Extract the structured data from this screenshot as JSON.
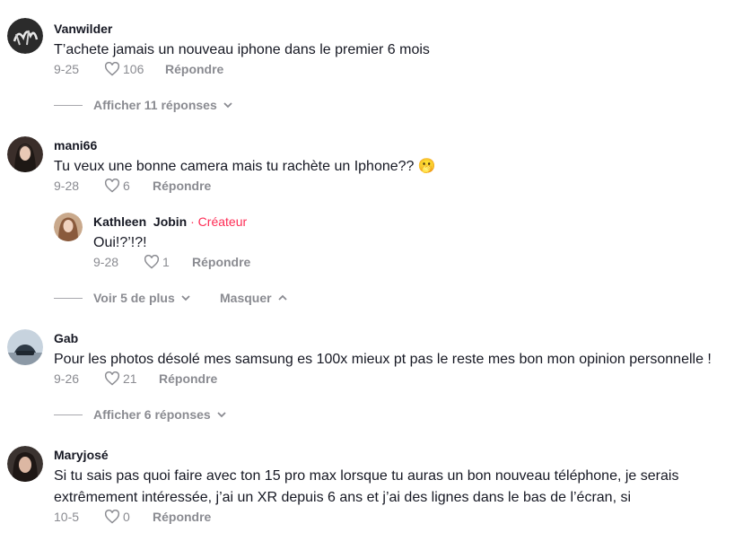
{
  "comments": [
    {
      "username": "Vanwilder",
      "text": "T’achete jamais un nouveau iphone dans le premier 6 mois",
      "date": "9-25",
      "likes": "106",
      "reply_label": "Répondre",
      "thread_label": "Afficher 11 réponses"
    },
    {
      "username": "mani66",
      "text": "Tu veux une bonne camera mais tu rachète un Iphone?? 🫢",
      "date": "9-28",
      "likes": "6",
      "reply_label": "Répondre",
      "reply": {
        "username": "Kathleen  Jobin",
        "creator_label": " · Créateur",
        "text": "Oui!?’!?!",
        "date": "9-28",
        "likes": "1",
        "reply_label": "Répondre"
      },
      "more_label": "Voir 5 de plus",
      "hide_label": "Masquer"
    },
    {
      "username": "Gab",
      "text": "Pour les photos désolé mes samsung es 100x mieux pt pas le reste mes bon mon opinion personnelle !",
      "date": "9-26",
      "likes": "21",
      "reply_label": "Répondre",
      "thread_label": "Afficher 6 réponses"
    },
    {
      "username": "Maryjosé",
      "text_line1": "Si tu sais pas quoi faire avec ton 15 pro max lorsque tu auras un bon nouveau téléphone, je serais",
      "text_line2": "extrêmement intéressée, j’ai un XR depuis 6 ans et j’ai des lignes dans le bas de l’écran, si",
      "date": "10-5",
      "likes": "0",
      "reply_label": "Répondre"
    }
  ]
}
